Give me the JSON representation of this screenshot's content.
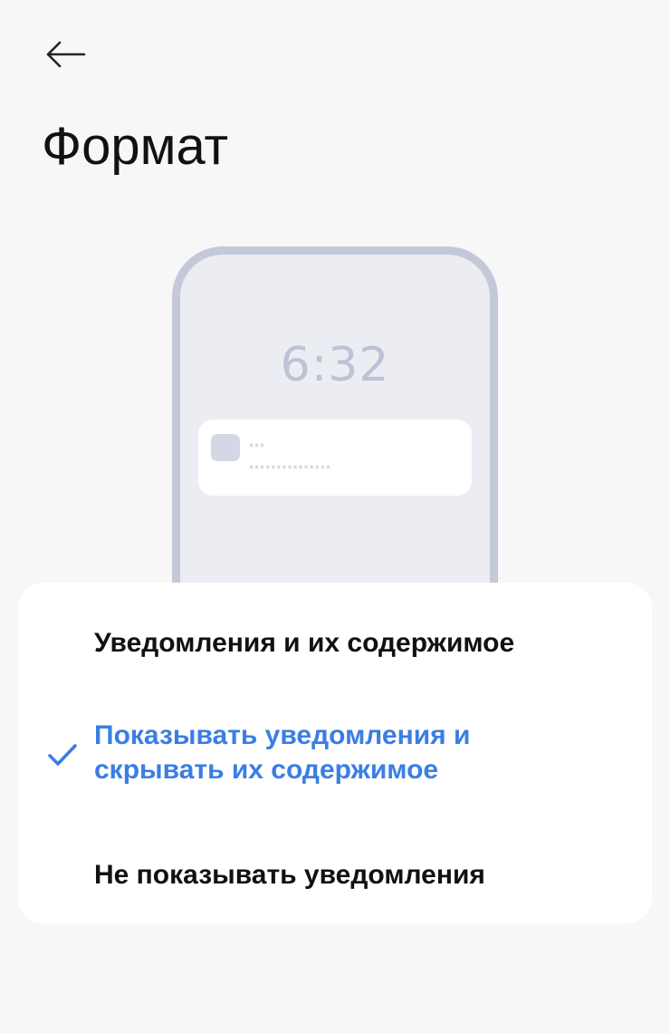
{
  "header": {
    "back_icon": "arrow-left-icon",
    "title": "Формат"
  },
  "preview": {
    "clock": "6:32",
    "notification": {
      "line1": "***",
      "line2": "***************"
    }
  },
  "options": [
    {
      "label": "Уведомления и их содержимое",
      "selected": false
    },
    {
      "label": "Показывать уведомления и скрывать их содержимое",
      "selected": true
    },
    {
      "label": "Не показывать уведомления",
      "selected": false
    }
  ],
  "colors": {
    "accent": "#3a7ee4",
    "background": "#f7f7f7",
    "card": "#ffffff",
    "phone_frame": "#c3c9d9"
  },
  "icons": {
    "check": "check-icon"
  }
}
